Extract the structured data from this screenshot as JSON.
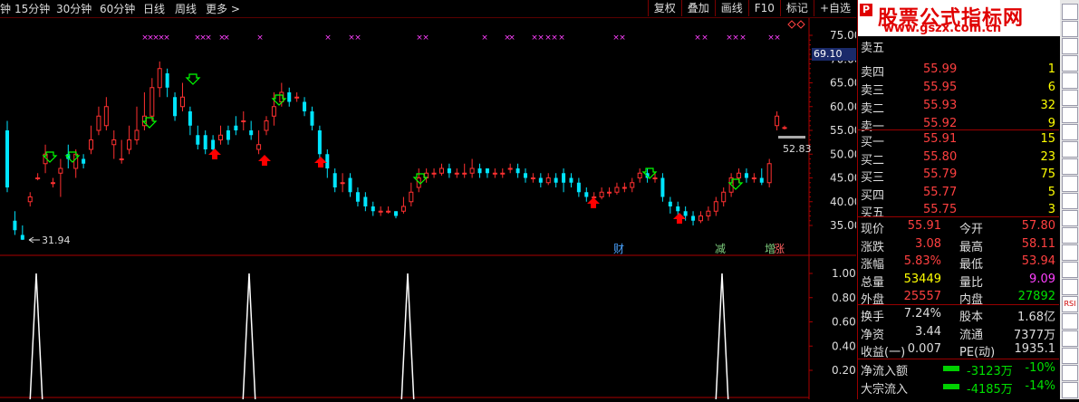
{
  "toolbar": {
    "periods": [
      "钟",
      "15分钟",
      "30分钟",
      "60分钟",
      "日线",
      "周线",
      "更多 >"
    ],
    "buttons": [
      "复权",
      "叠加",
      "画线",
      "F10",
      "标记",
      "+自选"
    ]
  },
  "chart": {
    "price_axis": [
      "75.00",
      "70.00",
      "65.00",
      "60.00",
      "55.00",
      "50.00",
      "45.00",
      "40.00",
      "35.00"
    ],
    "current_price_tag": "69.10",
    "high_marker": "52.83",
    "low_marker": "31.94",
    "events": [
      "财",
      "减",
      "增",
      "涨"
    ],
    "indicator_axis": [
      "1.00",
      "0.80",
      "0.60",
      "0.40",
      "0.20"
    ]
  },
  "colors": {
    "up": "#ff3030",
    "down": "#00e5ff",
    "signal": "#ff40ff",
    "buy_arrow": "#00ff00",
    "sell_arrow": "#ff0000"
  },
  "panel": {
    "logo_line1": "股票公式指标网",
    "logo_line2": "www.gszx.com.cn",
    "logo_badge": "P",
    "sell_rows": [
      {
        "label": "卖五",
        "price": "",
        "vol": ""
      },
      {
        "label": "卖四",
        "price": "55.99",
        "vol": "1"
      },
      {
        "label": "卖三",
        "price": "55.95",
        "vol": "6"
      },
      {
        "label": "卖二",
        "price": "55.93",
        "vol": "32"
      },
      {
        "label": "卖一",
        "price": "55.92",
        "vol": "9"
      }
    ],
    "buy_rows": [
      {
        "label": "买一",
        "price": "55.91",
        "vol": "15"
      },
      {
        "label": "买二",
        "price": "55.80",
        "vol": "23"
      },
      {
        "label": "买三",
        "price": "55.79",
        "vol": "75"
      },
      {
        "label": "买四",
        "price": "55.77",
        "vol": "5"
      },
      {
        "label": "买五",
        "price": "55.75",
        "vol": "3"
      }
    ],
    "quote": [
      {
        "l1": "现价",
        "v1": "55.91",
        "c1": "red",
        "l2": "今开",
        "v2": "57.80",
        "c2": "red"
      },
      {
        "l1": "涨跌",
        "v1": "3.08",
        "c1": "red",
        "l2": "最高",
        "v2": "58.11",
        "c2": "red"
      },
      {
        "l1": "涨幅",
        "v1": "5.83%",
        "c1": "red",
        "l2": "最低",
        "v2": "53.94",
        "c2": "red"
      },
      {
        "l1": "总量",
        "v1": "53449",
        "c1": "yellow",
        "l2": "量比",
        "v2": "9.09",
        "c2": "mag"
      },
      {
        "l1": "外盘",
        "v1": "25557",
        "c1": "red",
        "l2": "内盘",
        "v2": "27892",
        "c2": "green"
      }
    ],
    "stats": [
      {
        "l1": "换手",
        "v1": "7.24%",
        "l2": "股本",
        "v2": "1.68亿"
      },
      {
        "l1": "净资",
        "v1": "3.44",
        "l2": "流通",
        "v2": "7377万"
      },
      {
        "l1": "收益(一)",
        "v1": "0.007",
        "l2": "PE(动)",
        "v2": "1935.1"
      }
    ],
    "flows": [
      {
        "label": "净流入额",
        "value": "-3123万",
        "pct": "-10%"
      },
      {
        "label": "大宗流入",
        "value": "-4185万",
        "pct": "-14%"
      }
    ]
  },
  "strip_icons": [
    "",
    "",
    "",
    "",
    "",
    "",
    "",
    "",
    "",
    "",
    "",
    "",
    "",
    "",
    "",
    "",
    "",
    "RSI",
    "",
    "",
    "",
    "",
    ""
  ]
}
